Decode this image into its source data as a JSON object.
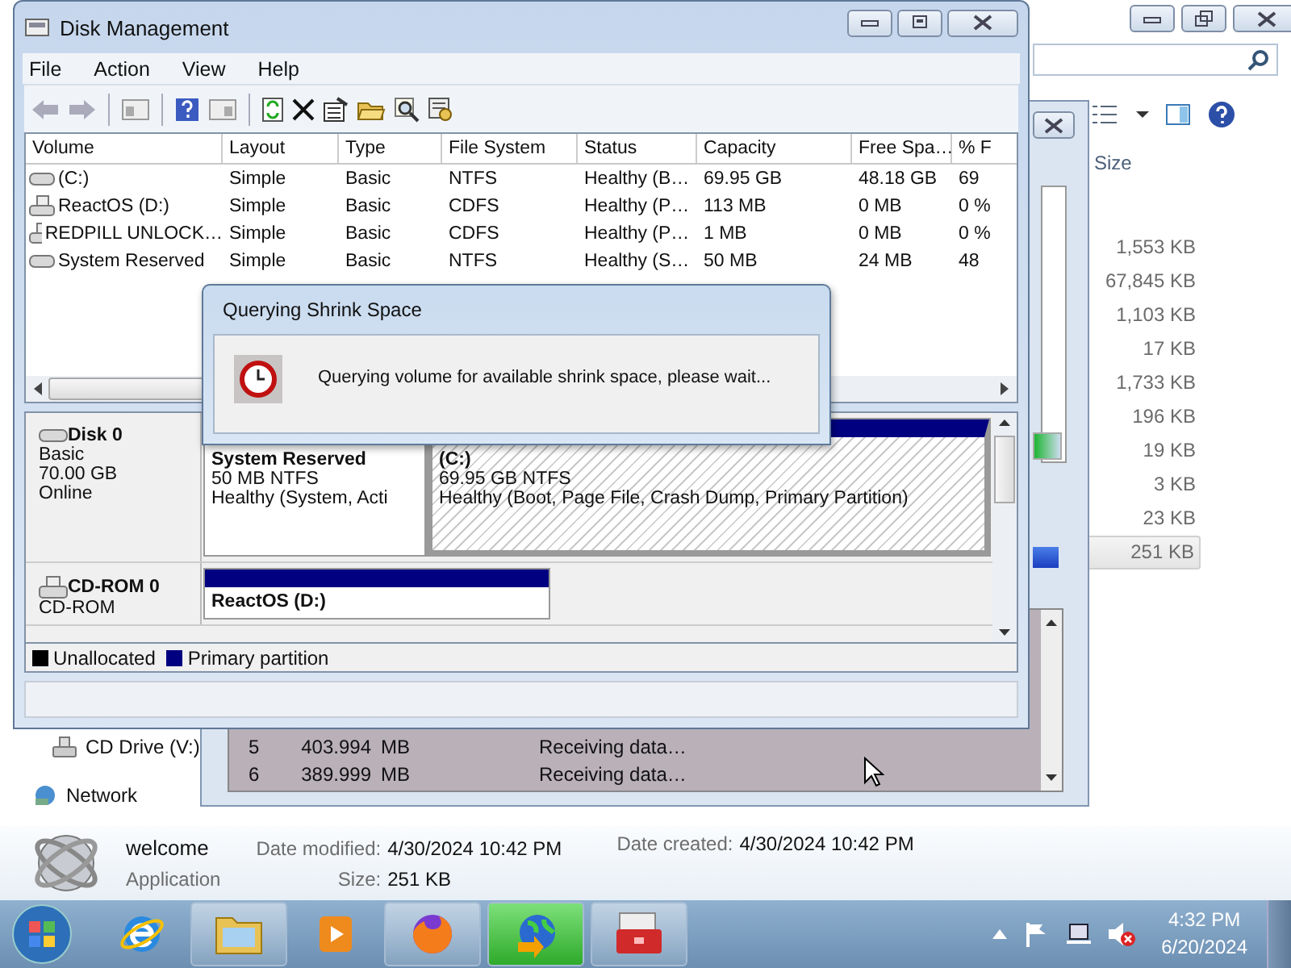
{
  "explorer": {
    "size_header": "Size",
    "sizes": [
      {
        "text": "1,553 KB",
        "selected": false
      },
      {
        "text": "67,845 KB",
        "selected": false
      },
      {
        "text": "1,103 KB",
        "selected": false
      },
      {
        "text": "17 KB",
        "selected": false
      },
      {
        "text": "1,733 KB",
        "selected": false
      },
      {
        "text": "196 KB",
        "selected": false
      },
      {
        "text": "19 KB",
        "selected": false
      },
      {
        "text": "3 KB",
        "selected": false
      },
      {
        "text": "23 KB",
        "selected": false
      },
      {
        "text": "251 KB",
        "selected": true
      }
    ],
    "nav": [
      {
        "kind": "drive",
        "label": "CD Drive (V:)"
      },
      {
        "kind": "network",
        "label": "Network"
      }
    ],
    "details": {
      "name": "welcome",
      "type": "Application",
      "modified_label": "Date modified:",
      "modified": "4/30/2024 10:42 PM",
      "created_label": "Date created:",
      "created": "4/30/2024 10:42 PM",
      "size_label": "Size:",
      "size": "251 KB"
    }
  },
  "downloads": {
    "rows": [
      {
        "num": "5",
        "size": "403.994",
        "unit": "MB",
        "status": "Receiving data…"
      },
      {
        "num": "6",
        "size": "389.999",
        "unit": "MB",
        "status": "Receiving data…"
      }
    ]
  },
  "disk_management": {
    "title": "Disk Management",
    "menu": [
      "File",
      "Action",
      "View",
      "Help"
    ],
    "columns": [
      "Volume",
      "Layout",
      "Type",
      "File System",
      "Status",
      "Capacity",
      "Free Spa…",
      "% F"
    ],
    "volumes": [
      {
        "kind": "disk",
        "cells": [
          "(C:)",
          "Simple",
          "Basic",
          "NTFS",
          "Healthy (B…",
          "69.95 GB",
          "48.18 GB",
          "69"
        ]
      },
      {
        "kind": "cd",
        "cells": [
          "ReactOS (D:)",
          "Simple",
          "Basic",
          "CDFS",
          "Healthy (P…",
          "113 MB",
          "0 MB",
          "0 %"
        ]
      },
      {
        "kind": "cd",
        "cells": [
          "REDPILL UNLOCK…",
          "Simple",
          "Basic",
          "CDFS",
          "Healthy (P…",
          "1 MB",
          "0 MB",
          "0 %"
        ]
      },
      {
        "kind": "disk",
        "cells": [
          "System Reserved",
          "Simple",
          "Basic",
          "NTFS",
          "Healthy (S…",
          "50 MB",
          "24 MB",
          "48"
        ]
      }
    ],
    "disks": [
      {
        "kind": "disk",
        "name": "Disk 0",
        "lines": [
          "Basic",
          "70.00 GB",
          "Online"
        ],
        "partitions": [
          {
            "name": "System Reserved",
            "size": "50 MB NTFS",
            "status": "Healthy (System, Acti",
            "selected": false
          },
          {
            "name": "(C:)",
            "size": "69.95 GB NTFS",
            "status": "Healthy (Boot, Page File, Crash Dump, Primary Partition)",
            "selected": true
          }
        ]
      },
      {
        "kind": "cd",
        "name": "CD-ROM 0",
        "lines": [
          "CD-ROM"
        ],
        "partitions": [
          {
            "name": "ReactOS  (D:)",
            "selected": false
          }
        ]
      }
    ],
    "legend": [
      {
        "label": "Unallocated",
        "color": "#000000"
      },
      {
        "label": "Primary partition",
        "color": "#000080"
      }
    ]
  },
  "dialog": {
    "title": "Querying Shrink Space",
    "message": "Querying volume for available shrink space, please wait..."
  },
  "taskbar": {
    "time": "4:32 PM",
    "date": "6/20/2024"
  }
}
